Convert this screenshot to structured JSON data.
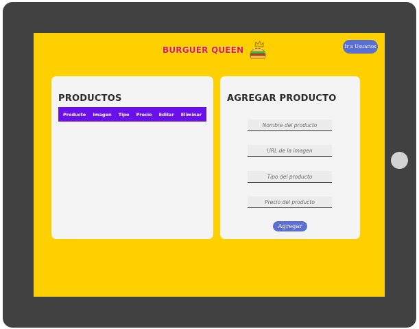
{
  "brand": {
    "name": "BURGUER QUEEN",
    "logo_icon": "burger-crown-icon"
  },
  "nav": {
    "users_button": "Ir a Usuarios"
  },
  "products": {
    "title": "PRODUCTOS",
    "columns": [
      "Producto",
      "Imagen",
      "Tipo",
      "Precio",
      "Editar",
      "Eliminar"
    ]
  },
  "add_product": {
    "title": "AGREGAR PRODUCTO",
    "name_placeholder": "Nombre del producto",
    "image_placeholder": "URL de la imagen",
    "type_placeholder": "Tipo del producto",
    "price_placeholder": "Precio del producto",
    "submit_label": "Agregar"
  },
  "colors": {
    "background": "#ffd000",
    "accent": "#6a10e8",
    "button": "#5b6fd0",
    "brand": "#e3173c",
    "frame": "#414141"
  }
}
